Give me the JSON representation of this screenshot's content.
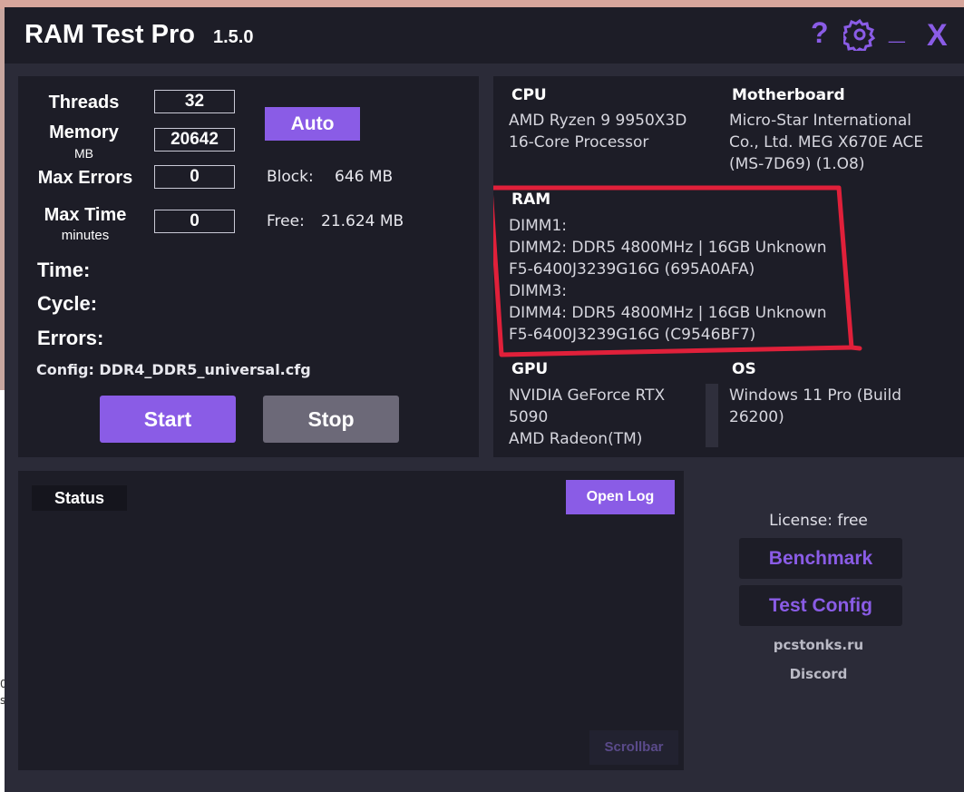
{
  "window": {
    "title": "RAM Test Pro",
    "version": "1.5.0"
  },
  "titlebar": {
    "help_label": "?",
    "settings_icon": "gear-icon",
    "minimize_label": "_",
    "close_label": "X"
  },
  "params": {
    "threads_label": "Threads",
    "threads_value": "32",
    "memory_label": "Memory",
    "memory_unit": "MB",
    "memory_value": "20642",
    "max_errors_label": "Max Errors",
    "max_errors_value": "0",
    "max_time_label": "Max Time",
    "max_time_unit": "minutes",
    "max_time_value": "0",
    "auto_label": "Auto",
    "block_label": "Block:",
    "block_value": "646 MB",
    "free_label": "Free:",
    "free_value": "21.624 MB",
    "time_label": "Time:",
    "cycle_label": "Cycle:",
    "errors_label": "Errors:",
    "config_text": "Config: DDR4_DDR5_universal.cfg",
    "start_label": "Start",
    "stop_label": "Stop"
  },
  "info": {
    "cpu_heading": "CPU",
    "cpu_text": "AMD Ryzen 9 9950X3D\n16-Core Processor",
    "motherboard_heading": "Motherboard",
    "motherboard_text": "Micro-Star International\nCo., Ltd. MEG X670E ACE\n(MS-7D69) (1.O8)",
    "ram_heading": "RAM",
    "ram_text": "DIMM1:\nDIMM2: DDR5 4800MHz | 16GB Unknown\nF5-6400J3239G16G (695A0AFA)\nDIMM3:\nDIMM4: DDR5 4800MHz | 16GB Unknown\nF5-6400J3239G16G (C9546BF7)",
    "gpu_heading": "GPU",
    "gpu_text": "NVIDIA GeForce RTX\n5090\nAMD Radeon(TM)",
    "os_heading": "OS",
    "os_text": "Windows 11 Pro (Build\n26200)"
  },
  "status": {
    "label": "Status",
    "open_log_label": "Open Log",
    "scrollbar_label": "Scrollbar"
  },
  "side": {
    "license_text": "License: free",
    "benchmark_label": "Benchmark",
    "test_config_label": "Test Config",
    "site_link": "pcstonks.ru",
    "discord_link": "Discord"
  },
  "background_text": [
    "0",
    "s"
  ],
  "colors": {
    "accent": "#8a5ce6",
    "panel": "#1d1d27",
    "window": "#2b2b38",
    "highlight": "#e0203a"
  }
}
